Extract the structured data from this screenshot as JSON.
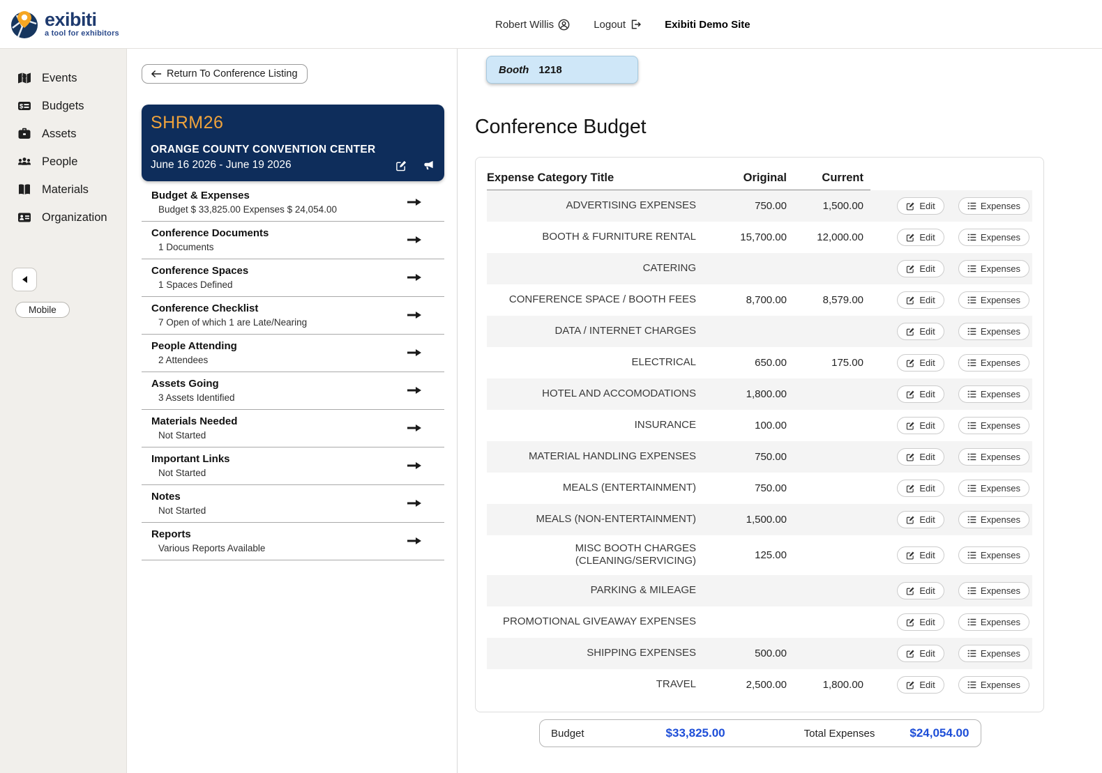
{
  "header": {
    "brand": "exibiti",
    "tagline": "a tool for exhibitors",
    "user_name": "Robert Willis",
    "logout_label": "Logout",
    "site_name": "Exibiti Demo Site"
  },
  "sidebar": {
    "items": [
      {
        "label": "Events",
        "icon": "map-icon"
      },
      {
        "label": "Budgets",
        "icon": "money-card-icon"
      },
      {
        "label": "Assets",
        "icon": "briefcase-icon"
      },
      {
        "label": "People",
        "icon": "people-icon"
      },
      {
        "label": "Materials",
        "icon": "book-icon"
      },
      {
        "label": "Organization",
        "icon": "id-card-icon"
      }
    ],
    "mobile_button_label": "Mobile"
  },
  "left_panel": {
    "return_button_label": "Return To Conference Listing",
    "conference": {
      "code": "SHRM26",
      "venue": "ORANGE COUNTY CONVENTION CENTER",
      "dates": "June 16 2026 - June 19 2026"
    },
    "sections": [
      {
        "title": "Budget & Expenses",
        "subtitle": "Budget $ 33,825.00 Expenses $ 24,054.00"
      },
      {
        "title": "Conference Documents",
        "subtitle": "1 Documents"
      },
      {
        "title": "Conference Spaces",
        "subtitle": "1 Spaces Defined"
      },
      {
        "title": "Conference Checklist",
        "subtitle": "7 Open of which 1 are Late/Nearing"
      },
      {
        "title": "People Attending",
        "subtitle": "2 Attendees"
      },
      {
        "title": "Assets Going",
        "subtitle": "3 Assets Identified"
      },
      {
        "title": "Materials Needed",
        "subtitle": "Not Started"
      },
      {
        "title": "Important Links",
        "subtitle": "Not Started"
      },
      {
        "title": "Notes",
        "subtitle": "Not Started"
      },
      {
        "title": "Reports",
        "subtitle": "Various Reports Available"
      }
    ]
  },
  "main": {
    "booth_label": "Booth",
    "booth_number": "1218",
    "title": "Conference Budget",
    "table": {
      "col_category": "Expense Category Title",
      "col_original": "Original",
      "col_current": "Current",
      "edit_label": "Edit",
      "expenses_label": "Expenses",
      "rows": [
        {
          "category": "ADVERTISING EXPENSES",
          "original": "750.00",
          "current": "1,500.00"
        },
        {
          "category": "BOOTH & FURNITURE RENTAL",
          "original": "15,700.00",
          "current": "12,000.00"
        },
        {
          "category": "CATERING",
          "original": "",
          "current": ""
        },
        {
          "category": "CONFERENCE SPACE / BOOTH FEES",
          "original": "8,700.00",
          "current": "8,579.00"
        },
        {
          "category": "DATA / INTERNET CHARGES",
          "original": "",
          "current": ""
        },
        {
          "category": "ELECTRICAL",
          "original": "650.00",
          "current": "175.00"
        },
        {
          "category": "HOTEL AND ACCOMODATIONS",
          "original": "1,800.00",
          "current": ""
        },
        {
          "category": "INSURANCE",
          "original": "100.00",
          "current": ""
        },
        {
          "category": "MATERIAL HANDLING EXPENSES",
          "original": "750.00",
          "current": ""
        },
        {
          "category": "MEALS (ENTERTAINMENT)",
          "original": "750.00",
          "current": ""
        },
        {
          "category": "MEALS (NON-ENTERTAINMENT)",
          "original": "1,500.00",
          "current": ""
        },
        {
          "category": "MISC BOOTH CHARGES (CLEANING/SERVICING)",
          "original": "125.00",
          "current": ""
        },
        {
          "category": "PARKING & MILEAGE",
          "original": "",
          "current": ""
        },
        {
          "category": "PROMOTIONAL GIVEAWAY EXPENSES",
          "original": "",
          "current": ""
        },
        {
          "category": "SHIPPING EXPENSES",
          "original": "500.00",
          "current": ""
        },
        {
          "category": "TRAVEL",
          "original": "2,500.00",
          "current": "1,800.00"
        }
      ]
    },
    "summary": {
      "budget_label": "Budget",
      "budget_value": "$33,825.00",
      "total_expenses_label": "Total Expenses",
      "total_expenses_value": "$24,054.00"
    }
  },
  "colors": {
    "navy_card": "#0e2d5b",
    "conference_code_orange": "#f0a33c",
    "booth_badge_blue": "#cfe7f8",
    "amount_blue": "#1d4ed8",
    "sidebar_bg": "#f1efeb",
    "row_stripe": "#f4f4f4"
  }
}
